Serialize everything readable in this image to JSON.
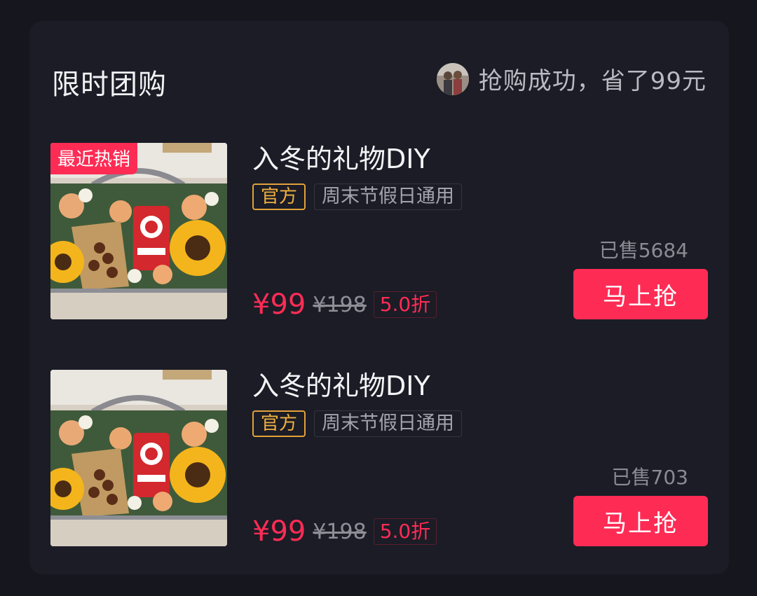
{
  "section": {
    "title": "限时团购",
    "ticker": "抢购成功，省了99元"
  },
  "items": [
    {
      "badge": "最近热销",
      "title": "入冬的礼物DIY",
      "tag_official": "官方",
      "tag_general": "周末节假日通用",
      "sold": "已售5684",
      "price": "¥99",
      "original_price": "¥198",
      "discount": "5.0折",
      "button": "马上抢"
    },
    {
      "title": "入冬的礼物DIY",
      "tag_official": "官方",
      "tag_general": "周末节假日通用",
      "sold": "已售703",
      "price": "¥99",
      "original_price": "¥198",
      "discount": "5.0折",
      "button": "马上抢"
    }
  ],
  "colors": {
    "background": "#15161e",
    "card": "#1b1c26",
    "accent": "#fe2c55",
    "official_tag": "#f0b040"
  }
}
